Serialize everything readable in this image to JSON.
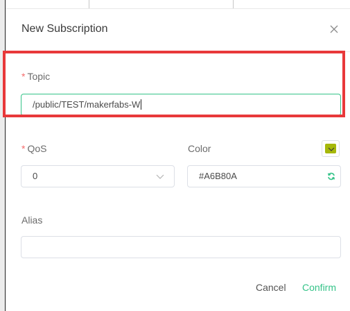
{
  "dialog": {
    "title": "New Subscription"
  },
  "topic": {
    "label": "Topic",
    "required_mark": "*",
    "value": "/public/TEST/makerfabs-W"
  },
  "qos": {
    "label": "QoS",
    "required_mark": "*",
    "selected": "0"
  },
  "color": {
    "label": "Color",
    "value": "#A6B80A",
    "swatch_hex": "#A6B80A"
  },
  "alias": {
    "label": "Alias",
    "value": ""
  },
  "footer": {
    "cancel_label": "Cancel",
    "confirm_label": "Confirm"
  },
  "theme": {
    "accent": "#34c388",
    "highlight": "#e8383a",
    "required": "#f56c6c"
  },
  "icons": {
    "close": "close-icon",
    "select_arrow": "chevron-down-icon",
    "refresh": "refresh-icon",
    "swatch_arrow": "chevron-down-icon"
  }
}
